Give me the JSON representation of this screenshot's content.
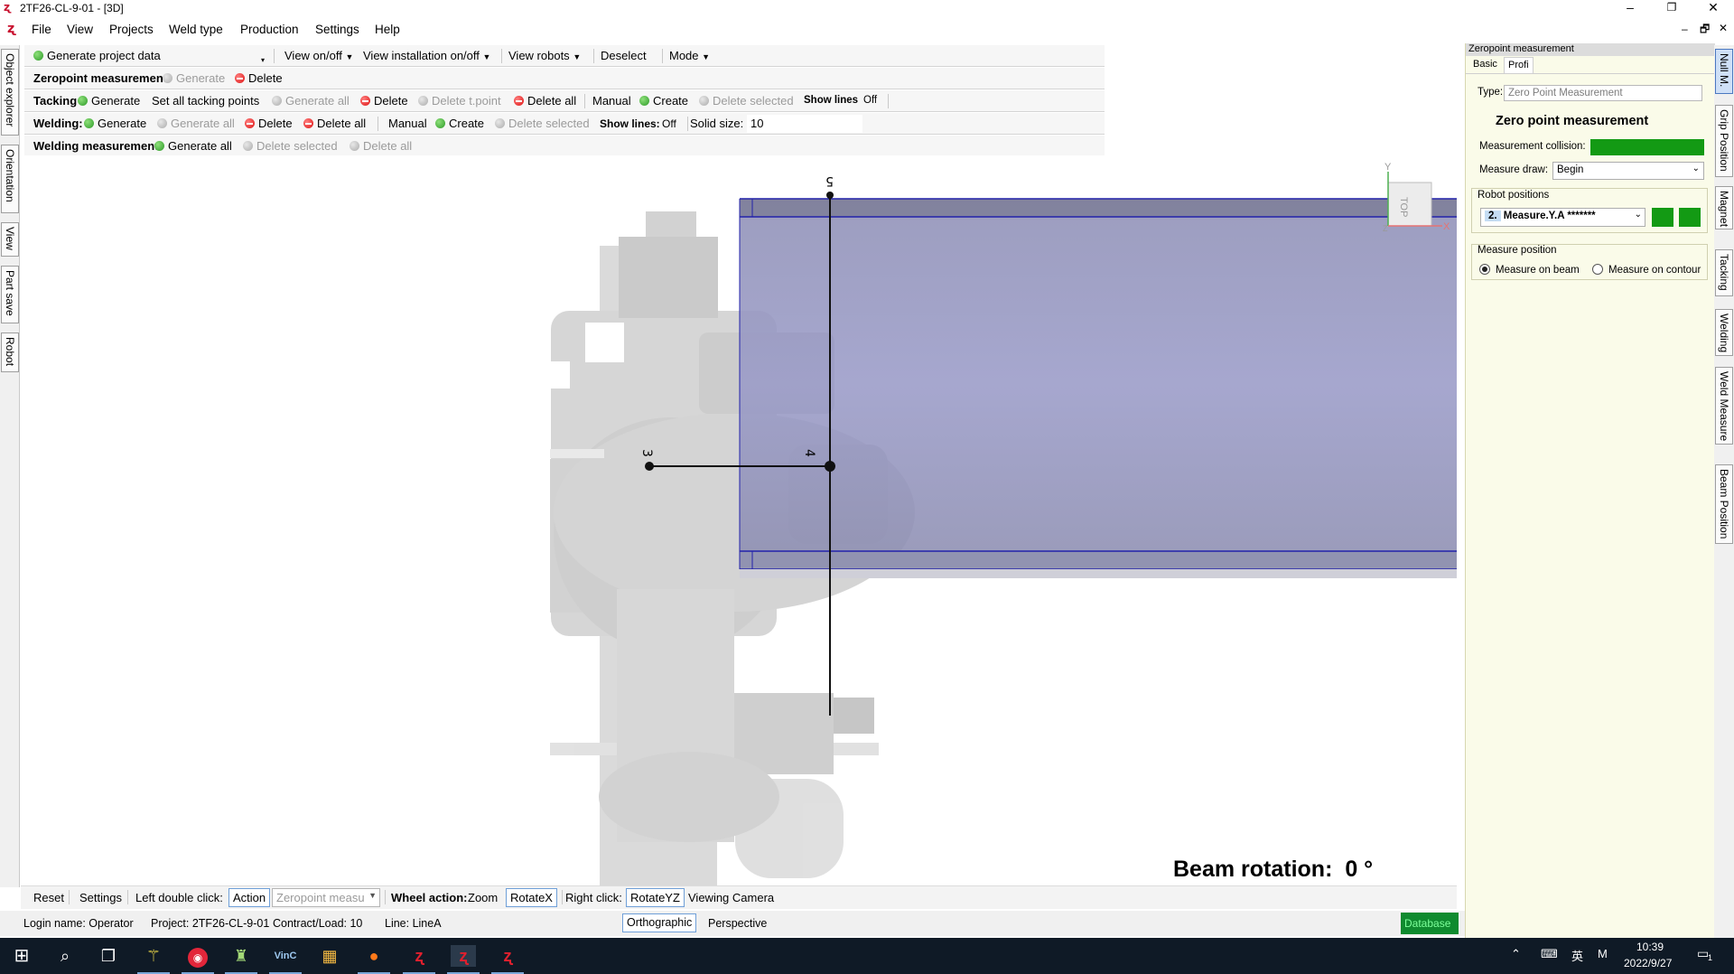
{
  "window": {
    "title": "2TF26-CL-9-01 - [3D]",
    "controls": [
      "–",
      "❐",
      "✕"
    ],
    "mdi_controls": [
      "–",
      "🗗",
      "✕"
    ]
  },
  "menu": [
    "File",
    "View",
    "Projects",
    "Weld type",
    "Production",
    "Settings",
    "Help"
  ],
  "left_tabs": [
    "Object explorer",
    "Orientation",
    "View",
    "Part save",
    "Robot"
  ],
  "right_tabs": [
    "Null M.",
    "Grip Position",
    "Magnet",
    "Tacking",
    "Welding",
    "Weld Measure",
    "Beam Position"
  ],
  "toolbar1": {
    "generate_project": "Generate project data",
    "view_onoff": "View on/off",
    "view_install": "View installation on/off",
    "view_robots": "View robots",
    "deselect": "Deselect",
    "mode": "Mode"
  },
  "toolbar2": {
    "label": "Zeropoint measurement",
    "generate": "Generate",
    "delete": "Delete"
  },
  "toolbar3": {
    "label": "Tacking",
    "generate": "Generate",
    "set_all": "Set all tacking points",
    "generate_all": "Generate all",
    "delete": "Delete",
    "delete_tpoint": "Delete t.point",
    "delete_all": "Delete all",
    "manual": "Manual",
    "create": "Create",
    "delete_selected": "Delete selected",
    "show_lines_label": "Show lines",
    "show_lines_value": "Off"
  },
  "toolbar4": {
    "label": "Welding:",
    "generate": "Generate",
    "generate_all": "Generate all",
    "delete": "Delete",
    "delete_all": "Delete all",
    "manual": "Manual",
    "create": "Create",
    "delete_selected": "Delete selected",
    "show_lines_label": "Show lines:",
    "show_lines_value": "Off",
    "solid_size_label": "Solid size:",
    "solid_size_value": "10"
  },
  "toolbar5": {
    "label": "Welding measurement",
    "generate_all": "Generate all",
    "delete_selected": "Delete selected",
    "delete_all": "Delete all"
  },
  "viewport": {
    "point_labels": [
      "5",
      "3",
      "4"
    ],
    "view_cube_label": "TOP",
    "axis_y": "Y",
    "axis_x": "X",
    "axis_z": "Z",
    "beam_rotation_label": "Beam rotation:",
    "beam_rotation_value": "0 °"
  },
  "bottombar": {
    "reset": "Reset",
    "settings": "Settings",
    "left_double_click": "Left double click:",
    "action": "Action",
    "action_select": "Zeropoint measu",
    "wheel_action": "Wheel action:",
    "zoom": "Zoom",
    "rotatex": "RotateX",
    "right_click": "Right click:",
    "rotateyz": "RotateYZ",
    "viewing_camera": "Viewing Camera"
  },
  "statusbar": {
    "login": "Login name:  Operator",
    "project": "Project:  2TF26-CL-9-01",
    "contract": "Contract/Load:  10",
    "line": "Line:  LineA",
    "orthographic": "Orthographic",
    "perspective": "Perspective",
    "database": "Database"
  },
  "rightpanel": {
    "header": "Zeropoint measurement",
    "tab_basic": "Basic",
    "tab_profi": "Profi",
    "type_label": "Type:",
    "type_value": "Zero Point Measurement",
    "heading": "Zero point measurement",
    "collision_label": "Measurement collision:",
    "measure_draw_label": "Measure draw:",
    "measure_draw_value": "Begin",
    "robot_positions_label": "Robot positions",
    "robot_position_num": "2.",
    "robot_position_value": "Measure.Y.A *******",
    "measure_position_label": "Measure position",
    "radio_beam": "Measure on beam",
    "radio_contour": "Measure on contour",
    "colors": {
      "collision": "#139a14",
      "panel_bg": "#fafbe9"
    }
  },
  "taskbar": {
    "time": "10:39",
    "date": "2022/9/27",
    "ime1": "英",
    "ime2": "M",
    "notify": "1"
  }
}
